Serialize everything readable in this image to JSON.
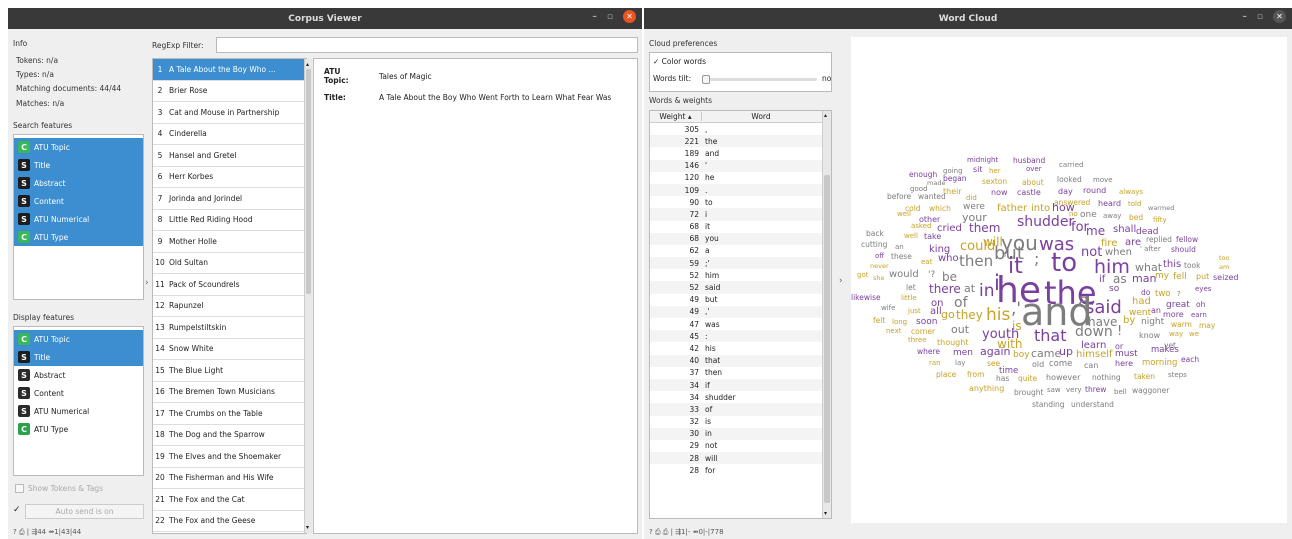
{
  "corpus": {
    "title": "Corpus Viewer",
    "info": {
      "header": "Info",
      "tokens": "Tokens: n/a",
      "types": "Types: n/a",
      "matching": "Matching documents: 44/44",
      "matches": "Matches: n/a"
    },
    "search_header": "Search features",
    "search_features": [
      {
        "t": "C",
        "label": "ATU Topic",
        "sel": true
      },
      {
        "t": "S",
        "label": "Title",
        "sel": true
      },
      {
        "t": "S",
        "label": "Abstract",
        "sel": true
      },
      {
        "t": "S",
        "label": "Content",
        "sel": true
      },
      {
        "t": "S",
        "label": "ATU Numerical",
        "sel": true
      },
      {
        "t": "C",
        "label": "ATU Type",
        "sel": true
      }
    ],
    "display_header": "Display features",
    "display_features": [
      {
        "t": "C",
        "label": "ATU Topic",
        "sel": true
      },
      {
        "t": "S",
        "label": "Title",
        "sel": true
      },
      {
        "t": "S",
        "label": "Abstract",
        "sel": false
      },
      {
        "t": "S",
        "label": "Content",
        "sel": false
      },
      {
        "t": "S",
        "label": "ATU Numerical",
        "sel": false
      },
      {
        "t": "C",
        "label": "ATU Type",
        "sel": false
      }
    ],
    "show_tokens": "Show Tokens & Tags",
    "auto_send": "Auto send is on",
    "regexp_label": "RegExp Filter:",
    "docs": [
      "A Tale About the Boy Who ...",
      "Brier Rose",
      "Cat and Mouse in Partnership",
      "Cinderella",
      "Hansel and Gretel",
      "Herr Korbes",
      "Jorinda and Jorindel",
      "Little Red Riding Hood",
      "Mother Holle",
      "Old Sultan",
      "Pack of Scoundrels",
      "Rapunzel",
      "Rumpelstiltskin",
      "Snow White",
      "The Blue Light",
      "The Bremen Town Musicians",
      "The Crumbs on the Table",
      "The Dog and the Sparrow",
      "The Elves and the Shoemaker",
      "The Fisherman and His Wife",
      "The Fox and the Cat",
      "The Fox and the Geese"
    ],
    "detail": {
      "k1a": "ATU",
      "k1b": "Topic:",
      "v1": "Tales of Magic",
      "k2": "Title:",
      "v2": "A Tale About the Boy Who Went Forth to Learn What Fear Was"
    },
    "status": "? ⎙ | ⇶44 ⇴1|43|44"
  },
  "wordcloud": {
    "title": "Word Cloud",
    "prefs_header": "Cloud preferences",
    "color_words": "✓ Color words",
    "tilt_label": "Words tilt:",
    "tilt_value": "no",
    "weights_header": "Words & weights",
    "col_weight": "Weight",
    "col_word": "Word",
    "rows": [
      [
        "305",
        ","
      ],
      [
        "221",
        "the"
      ],
      [
        "189",
        "and"
      ],
      [
        "146",
        "'"
      ],
      [
        "120",
        "he"
      ],
      [
        "109",
        "."
      ],
      [
        "90",
        "to"
      ],
      [
        "72",
        "i"
      ],
      [
        "68",
        "it"
      ],
      [
        "68",
        "you"
      ],
      [
        "62",
        "a"
      ],
      [
        "59",
        ";'"
      ],
      [
        "52",
        "him"
      ],
      [
        "52",
        "said"
      ],
      [
        "49",
        "but"
      ],
      [
        "49",
        ",'"
      ],
      [
        "47",
        "was"
      ],
      [
        "45",
        ":"
      ],
      [
        "42",
        "his"
      ],
      [
        "40",
        "that"
      ],
      [
        "37",
        "then"
      ],
      [
        "34",
        "if"
      ],
      [
        "34",
        "shudder"
      ],
      [
        "33",
        "of"
      ],
      [
        "32",
        "is"
      ],
      [
        "30",
        "in"
      ],
      [
        "29",
        "not"
      ],
      [
        "28",
        "will"
      ],
      [
        "28",
        "for"
      ]
    ],
    "status": "? ⎙ ⎙ | ⇶1|- ⇴0|-|778",
    "colors": {
      "purple": "#7b3fa0",
      "gray": "#7d7d7d",
      "gold": "#c9a227"
    }
  }
}
